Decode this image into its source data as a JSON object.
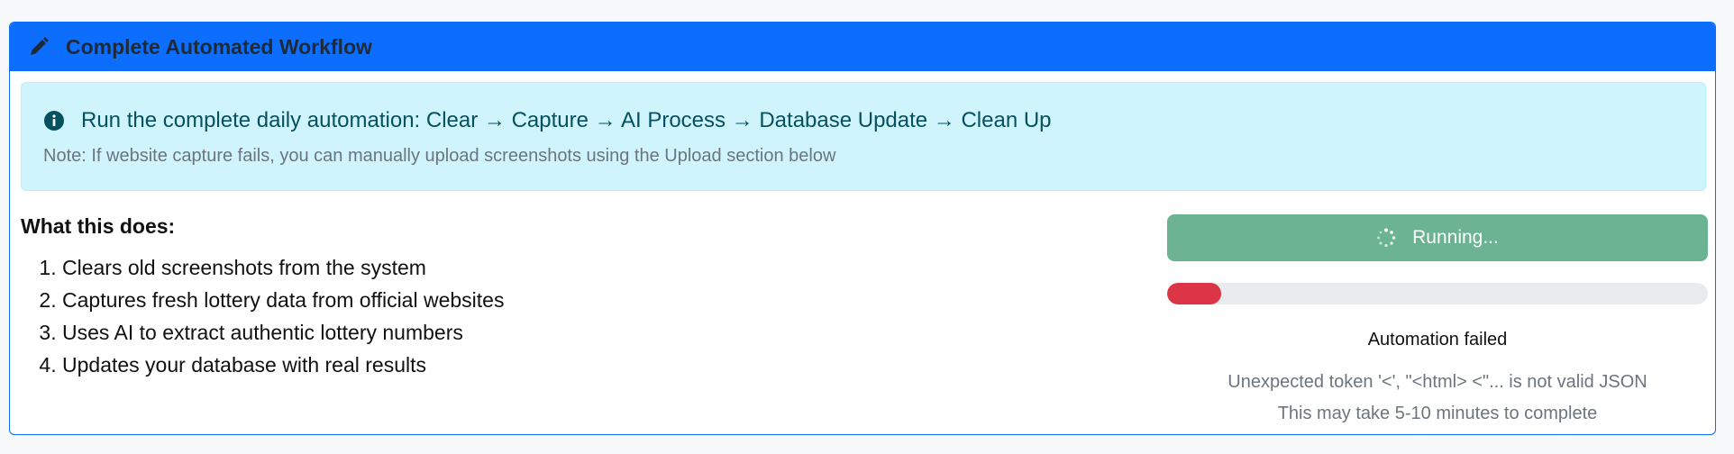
{
  "card": {
    "title": "Complete Automated Workflow",
    "header_icon": "pencil-icon",
    "accent_color": "#0d6efd"
  },
  "alert": {
    "icon": "info-circle-icon",
    "main_text": "Run the complete daily automation: Clear → Capture → AI Process → Database Update → Clean Up",
    "note": "Note: If website capture fails, you can manually upload screenshots using the Upload section below"
  },
  "what_this_does": {
    "heading": "What this does:",
    "steps": [
      "Clears old screenshots from the system",
      "Captures fresh lottery data from official websites",
      "Uses AI to extract authentic lottery numbers",
      "Updates your database with real results"
    ]
  },
  "run": {
    "button_label": "Running...",
    "spinner_icon": "spinner-icon",
    "button_color": "#6bb391",
    "progress_fraction": 0.1,
    "progress_color": "#dc3545",
    "status_text": "Automation failed",
    "error_text": "Unexpected token '<', \"<html> <\"... is not valid JSON",
    "hint_text": "This may take 5-10 minutes to complete"
  }
}
